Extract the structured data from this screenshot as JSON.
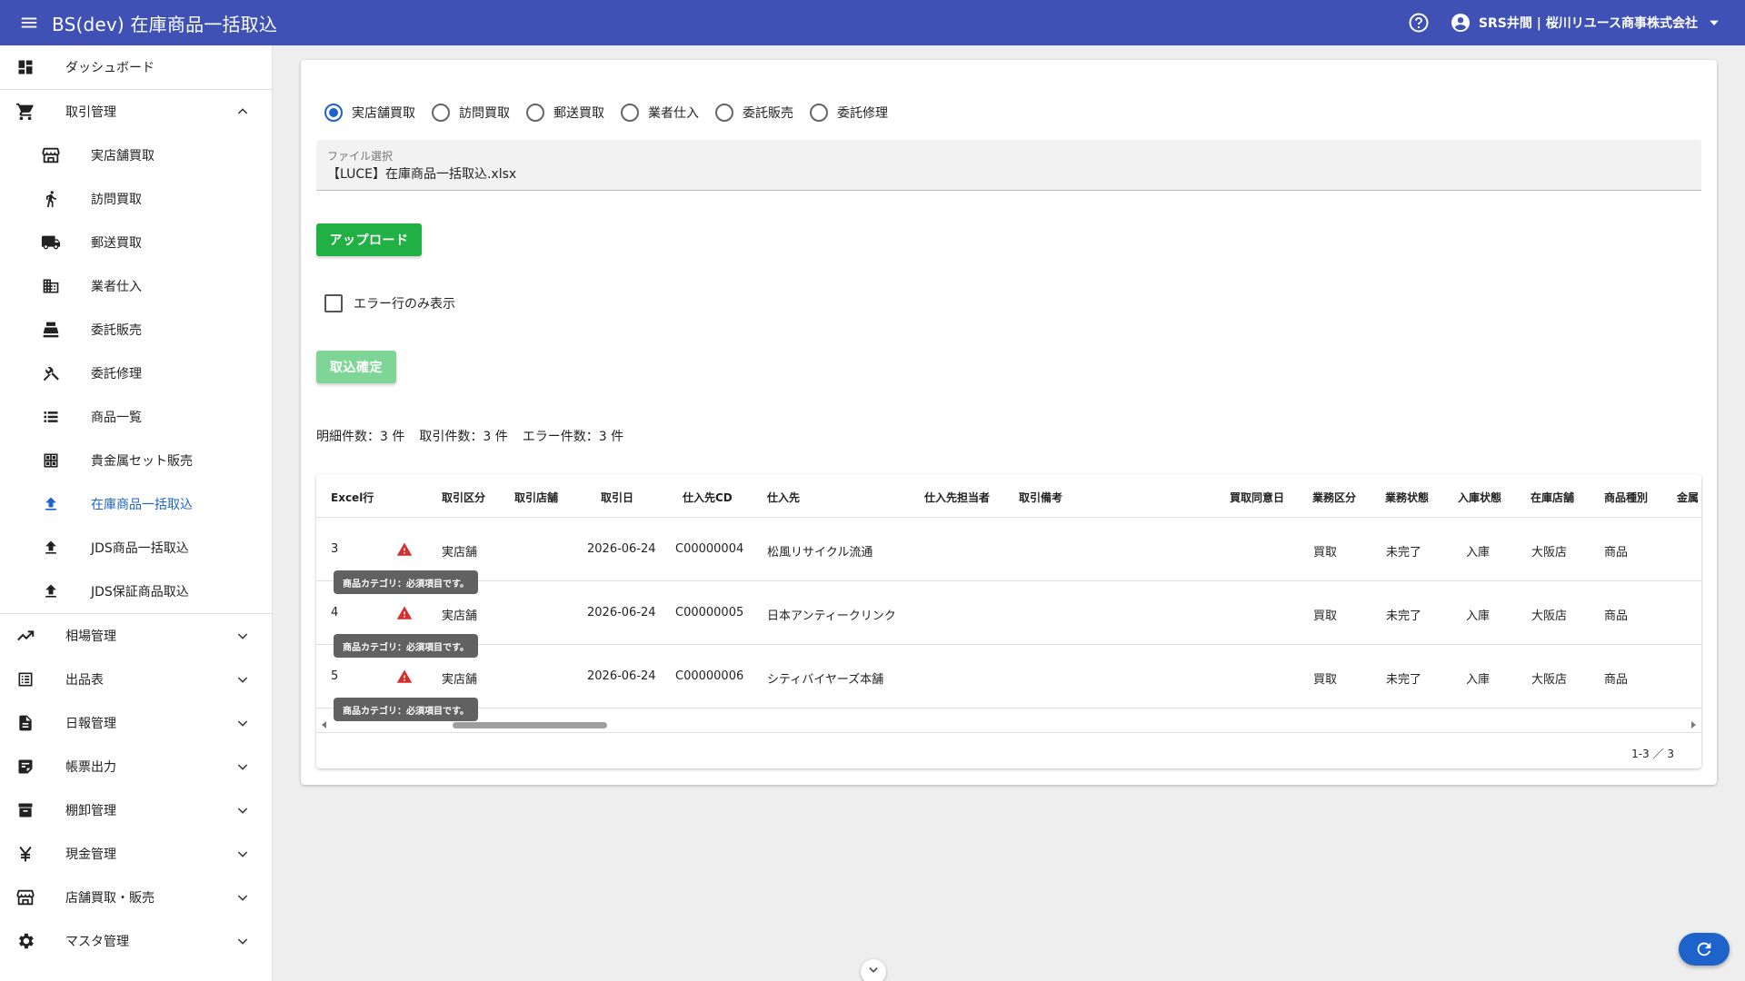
{
  "header": {
    "title": "BS(dev) 在庫商品一括取込",
    "user_name": "SRS井間 | 桜川リユース商事株式会社",
    "colors": {
      "appbar": "#3f51b5"
    }
  },
  "sidebar": {
    "dashboard": "ダッシュボード",
    "transaction_group": "取引管理",
    "sub_items": [
      {
        "label": "実店舗買取",
        "icon": "store-icon"
      },
      {
        "label": "訪問買取",
        "icon": "walk-icon"
      },
      {
        "label": "郵送買取",
        "icon": "truck-icon"
      },
      {
        "label": "業者仕入",
        "icon": "building-icon"
      },
      {
        "label": "委託販売",
        "icon": "register-icon"
      },
      {
        "label": "委託修理",
        "icon": "tools-icon"
      },
      {
        "label": "商品一覧",
        "icon": "list-icon"
      },
      {
        "label": "貴金属セット販売",
        "icon": "grid-icon"
      },
      {
        "label": "在庫商品一括取込",
        "icon": "upload-icon",
        "active": true
      },
      {
        "label": "JDS商品一括取込",
        "icon": "upload-icon"
      },
      {
        "label": "JDS保証商品取込",
        "icon": "upload-icon"
      }
    ],
    "groups": [
      {
        "label": "相場管理",
        "icon": "trending-icon"
      },
      {
        "label": "出品表",
        "icon": "list-box-icon"
      },
      {
        "label": "日報管理",
        "icon": "document-icon"
      },
      {
        "label": "帳票出力",
        "icon": "note-icon"
      },
      {
        "label": "棚卸管理",
        "icon": "archive-icon"
      },
      {
        "label": "現金管理",
        "icon": "yen-icon"
      },
      {
        "label": "店舗買取・販売",
        "icon": "store-icon"
      },
      {
        "label": "マスタ管理",
        "icon": "gear-icon"
      }
    ],
    "active_color": "#1e63c9"
  },
  "main": {
    "radios": [
      {
        "label": "実店舗買取",
        "checked": true
      },
      {
        "label": "訪問買取",
        "checked": false
      },
      {
        "label": "郵送買取",
        "checked": false
      },
      {
        "label": "業者仕入",
        "checked": false
      },
      {
        "label": "委託販売",
        "checked": false
      },
      {
        "label": "委託修理",
        "checked": false
      }
    ],
    "file_field": {
      "label": "ファイル選択",
      "value": "【LUCE】在庫商品一括取込.xlsx"
    },
    "upload_label": "アップロード",
    "error_only_label": "エラー行のみ表示",
    "confirm_label": "取込確定",
    "counts": {
      "detail": "明細件数：3 件",
      "transactions": "取引件数：3 件",
      "errors": "エラー件数：3 件"
    },
    "colors": {
      "upload": "#21b043",
      "confirm_disabled": "#7fd596",
      "warning": "#d32f2f"
    }
  },
  "table": {
    "columns": [
      "Excel行",
      "取引区分",
      "取引店舗",
      "取引日",
      "仕入先CD",
      "仕入先",
      "仕入先担当者",
      "取引備考",
      "買取同意日",
      "業務区分",
      "業務状態",
      "入庫状態",
      "在庫店舗",
      "商品種別",
      "金属"
    ],
    "rows": [
      {
        "excel_row": "3",
        "kind": "実店舗",
        "store": "",
        "date": "2026-06-24",
        "supplier_cd": "C00000004",
        "supplier": "松風リサイクル流通",
        "business": "買取",
        "status": "未完了",
        "stock_state": "入庫",
        "stock_store": "大阪店",
        "item_type": "商品",
        "error": "商品カテゴリ：必須項目です。"
      },
      {
        "excel_row": "4",
        "kind": "実店舗",
        "store": "",
        "date": "2026-06-24",
        "supplier_cd": "C00000005",
        "supplier": "日本アンティークリンク",
        "business": "買取",
        "status": "未完了",
        "stock_state": "入庫",
        "stock_store": "大阪店",
        "item_type": "商品",
        "error": "商品カテゴリ：必須項目です。"
      },
      {
        "excel_row": "5",
        "kind": "実店舗",
        "store": "",
        "date": "2026-06-24",
        "supplier_cd": "C00000006",
        "supplier": "シティバイヤーズ本舗",
        "business": "買取",
        "status": "未完了",
        "stock_state": "入庫",
        "stock_store": "大阪店",
        "item_type": "商品",
        "error": "商品カテゴリ：必須項目です。"
      }
    ],
    "pagination": "1-3 ／ 3"
  }
}
